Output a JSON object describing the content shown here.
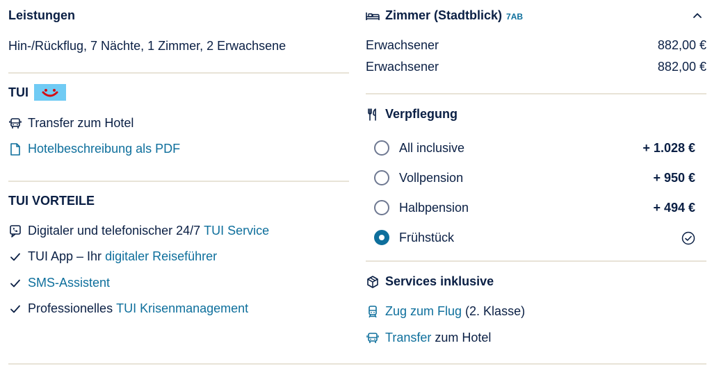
{
  "services": {
    "heading": "Leistungen",
    "summary": "Hin-/Rückflug, 7 Nächte, 1 Zimmer, 2 Erwachsene"
  },
  "tui": {
    "label": "TUI",
    "transfer": "Transfer zum Hotel",
    "pdf_link": "Hotelbeschreibung als PDF"
  },
  "advantages": {
    "heading": "TUI VORTEILE",
    "service_prefix": "Digitaler und telefonischer 24/7 ",
    "service_link": "TUI Service",
    "app_prefix": "TUI App – Ihr ",
    "app_link": "digitaler Reiseführer",
    "sms_link": "SMS-Assistent",
    "crisis_prefix": "Professionelles ",
    "crisis_link": "TUI Krisenmanagement"
  },
  "room": {
    "title": "Zimmer (Stadtblick)",
    "code": "7AB",
    "travellers": [
      {
        "label": "Erwachsener",
        "price": "882,00 €"
      },
      {
        "label": "Erwachsener",
        "price": "882,00 €"
      }
    ]
  },
  "board": {
    "heading": "Verpflegung",
    "options": [
      {
        "label": "All inclusive",
        "price": "+ 1.028 €",
        "selected": false
      },
      {
        "label": "Vollpension",
        "price": "+ 950 €",
        "selected": false
      },
      {
        "label": "Halbpension",
        "price": "+ 494 €",
        "selected": false
      },
      {
        "label": "Frühstück",
        "price": "",
        "selected": true
      }
    ]
  },
  "included": {
    "heading": "Services inklusive",
    "train_link": "Zug zum Flug",
    "train_suffix": " (2. Klasse)",
    "transfer_link": "Transfer",
    "transfer_suffix": " zum Hotel"
  },
  "colors": {
    "text": "#0a1f44",
    "link": "#0e6f9c",
    "divider": "#e8e3d7",
    "logo_bg": "#70cbf4",
    "logo_mark": "#d40e14"
  },
  "icons": {
    "bus": "bus-icon",
    "document": "document-icon",
    "service": "phone-chat-icon",
    "check": "checkmark-icon",
    "bed": "bed-icon",
    "cutlery": "cutlery-icon",
    "box": "box-icon",
    "train": "train-icon",
    "collapse": "chevron-up-icon"
  }
}
